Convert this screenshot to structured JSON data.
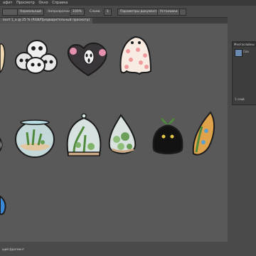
{
  "menu": [
    "афит",
    "Просмотр",
    "Окно",
    "Справка"
  ],
  "options": {
    "mode": "Нормальный",
    "opacity_label": "Непрозрачность:",
    "opacity_value": "100%",
    "layers_label": "Слоев:",
    "layers_value": "1",
    "doc_params": "Параметры документа",
    "settings": "Установки"
  },
  "tab": {
    "title": "ioort 1_a @ 25 % (RGB/Предварительный просмотр)"
  },
  "panel": {
    "title": "Многослойны",
    "tab": "Сло",
    "layer_count": "1 слой"
  },
  "status": {
    "text": "щий фрагмент"
  },
  "colors": {
    "bg": "#595959",
    "panel": "#3d3d3d",
    "menubar": "#3a3a3a",
    "selection": "#6a8ab3"
  }
}
